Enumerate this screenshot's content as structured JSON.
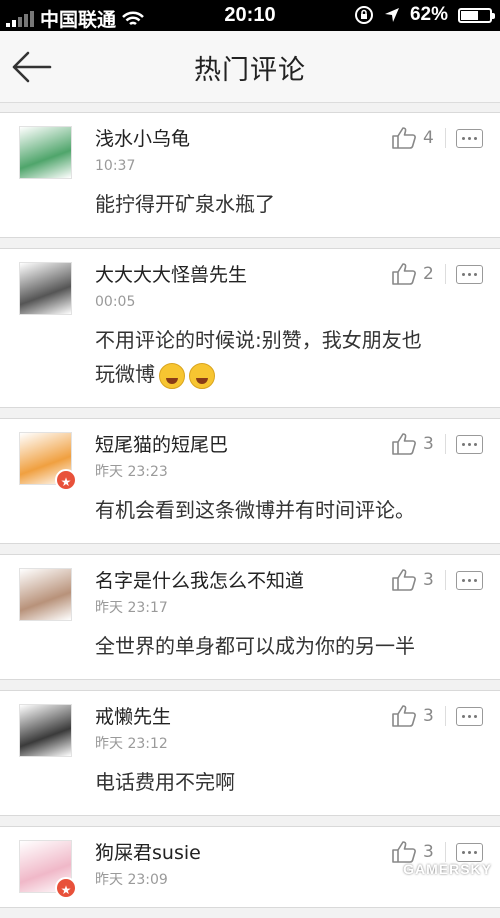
{
  "status_bar": {
    "carrier": "中国联通",
    "time": "20:10",
    "battery": "62%",
    "battery_level": 0.62
  },
  "nav": {
    "title": "热门评论",
    "back_icon": "arrow-left-icon"
  },
  "comments": [
    {
      "name": "浅水小乌龟",
      "time": "10:37",
      "text": "能拧得开矿泉水瓶了",
      "likes": "4",
      "badge": false,
      "avatar_color": "#4fa56b"
    },
    {
      "name": "大大大大怪兽先生",
      "time": "00:05",
      "text": "不用评论的时候说:别赞，我女朋友也玩微博",
      "likes": "2",
      "badge": false,
      "emojis": 2,
      "avatar_color": "#555555"
    },
    {
      "name": "短尾猫的短尾巴",
      "time": "昨天 23:23",
      "text": "有机会看到这条微博并有时间评论。",
      "likes": "3",
      "badge": true,
      "avatar_color": "#f0a040"
    },
    {
      "name": "名字是什么我怎么不知道",
      "time": "昨天 23:17",
      "text": "全世界的单身都可以成为你的另一半",
      "likes": "3",
      "badge": false,
      "avatar_color": "#b8927a"
    },
    {
      "name": "戒懒先生",
      "time": "昨天 23:12",
      "text": "电话费用不完啊",
      "likes": "3",
      "badge": false,
      "avatar_color": "#3a3a3a"
    },
    {
      "name": "狗屎君susie",
      "time": "昨天 23:09",
      "text": "",
      "likes": "3",
      "badge": true,
      "avatar_color": "#f0b8c8"
    }
  ],
  "watermark": "GAMERSKY"
}
